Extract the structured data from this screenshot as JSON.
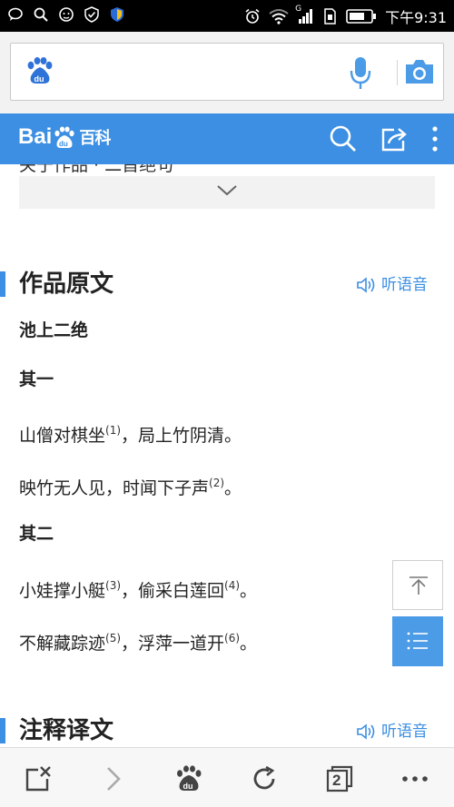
{
  "status_bar": {
    "time": "下午9:31",
    "network_label": "G",
    "icons": [
      "chat-bubble-icon",
      "search-icon",
      "cat-app-icon",
      "shield-check-icon",
      "security-shield-icon",
      "alarm-icon",
      "wifi-icon",
      "signal-icon",
      "sim-icon",
      "battery-icon"
    ]
  },
  "search": {
    "logo": "baidu-paw-icon",
    "value": "",
    "mic_icon": "microphone-icon",
    "camera_icon": "camera-icon"
  },
  "header": {
    "logo_text_prefix": "Bai",
    "logo_text_du": "du",
    "logo_text_suffix": "百科",
    "icons": [
      "search-icon",
      "share-icon",
      "more-vertical-icon"
    ]
  },
  "content": {
    "cut_off_line": "关于作品 · 二首绝句",
    "expand_icon": "chevron-down-icon",
    "section1": {
      "title": "作品原文",
      "listen_label": "听语音"
    },
    "poem_title": "池上二绝",
    "part1_title": "其一",
    "lines": [
      {
        "a": "山僧对棋坐",
        "a_note": "(1)",
        "b": "，局上竹阴清。",
        "b_note": ""
      },
      {
        "a": "映竹无人见，时闻下子声",
        "a_note": "(2)",
        "b": "。",
        "b_note": ""
      },
      {
        "a": "小娃撑小艇",
        "a_note": "(3)",
        "b": "，偷采白莲回",
        "b_note": "(4)",
        "c": "。"
      },
      {
        "a": "不解藏踪迹",
        "a_note": "(5)",
        "b": "，浮萍一道开",
        "b_note": "(6)",
        "c": "。"
      }
    ],
    "part2_title": "其二",
    "section2": {
      "title": "注释译文",
      "listen_label": "听语音"
    }
  },
  "floating": {
    "top_icon": "back-to-top-icon",
    "list_icon": "table-of-contents-icon"
  },
  "bottom_nav": {
    "tab_count": "2",
    "icons": [
      "close-page-icon",
      "forward-icon",
      "baidu-home-icon",
      "refresh-icon",
      "tabs-icon",
      "more-horizontal-icon"
    ]
  },
  "colors": {
    "brand_blue": "#3c8fe2",
    "fab_blue": "#4c9be6",
    "status_bar": "#000000"
  }
}
